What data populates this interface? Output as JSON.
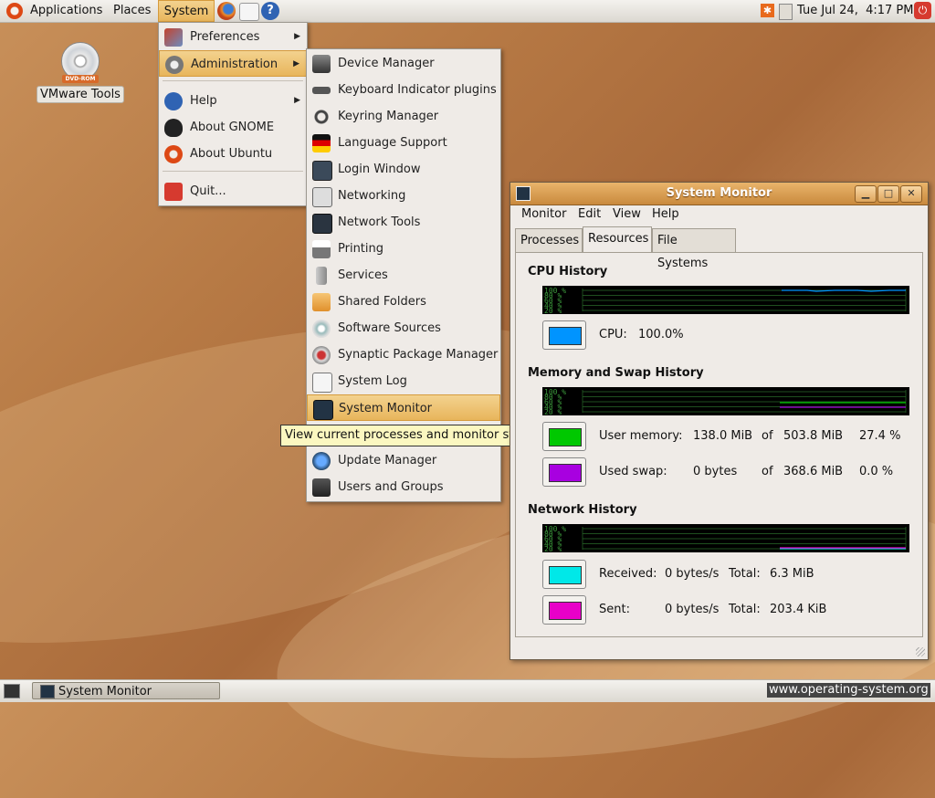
{
  "top_panel": {
    "applications": "Applications",
    "places": "Places",
    "system": "System",
    "clock": "Tue Jul 24,  4:17 PM"
  },
  "desktop": {
    "dvd_tag": "DVD-ROM",
    "icon_label": "VMware Tools"
  },
  "system_menu": {
    "items": [
      {
        "label": "Preferences"
      },
      {
        "label": "Administration"
      },
      {
        "label": "Help"
      },
      {
        "label": "About GNOME"
      },
      {
        "label": "About Ubuntu"
      },
      {
        "label": "Quit..."
      }
    ]
  },
  "admin_menu": {
    "items": [
      {
        "label": "Device Manager"
      },
      {
        "label": "Keyboard Indicator plugins"
      },
      {
        "label": "Keyring Manager"
      },
      {
        "label": "Language Support"
      },
      {
        "label": "Login Window"
      },
      {
        "label": "Networking"
      },
      {
        "label": "Network Tools"
      },
      {
        "label": "Printing"
      },
      {
        "label": "Services"
      },
      {
        "label": "Shared Folders"
      },
      {
        "label": "Software Sources"
      },
      {
        "label": "Synaptic Package Manager"
      },
      {
        "label": "System Log"
      },
      {
        "label": "System Monitor"
      },
      {
        "label": "Update Manager"
      },
      {
        "label": "Users and Groups"
      }
    ]
  },
  "tooltip": "View current processes and monitor system state",
  "window": {
    "title": "System Monitor",
    "menubar": [
      "Monitor",
      "Edit",
      "View",
      "Help"
    ],
    "tabs": [
      "Processes",
      "Resources",
      "File Systems"
    ],
    "cpu": {
      "heading": "CPU History",
      "label": "CPU:",
      "value": "100.0%",
      "color": "#0094ff"
    },
    "memory": {
      "heading": "Memory and Swap History",
      "user_label": "User memory:",
      "user_used": "138.0 MiB",
      "of": "of",
      "user_total": "503.8 MiB",
      "user_pct": "27.4 %",
      "user_color": "#00c800",
      "swap_label": "Used swap:",
      "swap_used": "0 bytes",
      "swap_total": "368.6 MiB",
      "swap_pct": "0.0 %",
      "swap_color": "#a800e0"
    },
    "network": {
      "heading": "Network History",
      "recv_label": "Received:",
      "recv_rate": "0 bytes/s",
      "total_label": "Total:",
      "recv_total": "6.3 MiB",
      "recv_color": "#00e8e8",
      "sent_label": "Sent:",
      "sent_rate": "0 bytes/s",
      "sent_total": "203.4 KiB",
      "sent_color": "#e800c8"
    },
    "graph_ticks": [
      "100 %",
      "80 %",
      "60 %",
      "40 %",
      "20 %"
    ]
  },
  "bottom_panel": {
    "task": "System Monitor"
  },
  "watermark": "www.operating-system.org"
}
